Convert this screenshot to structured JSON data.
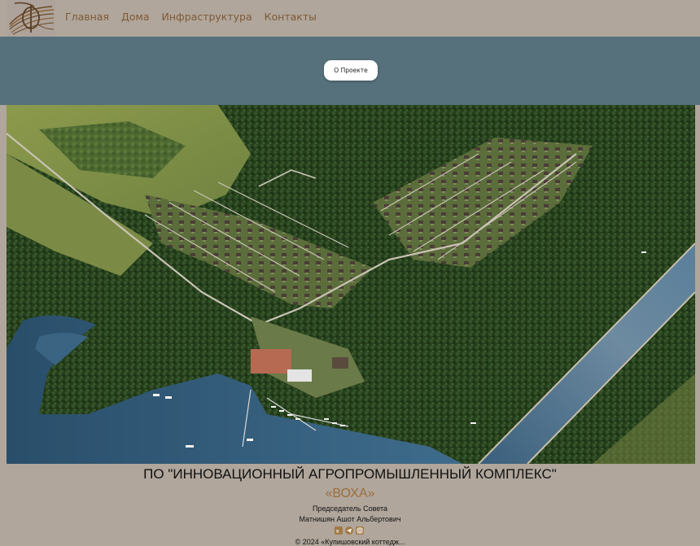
{
  "header": {
    "logo_icon": "fiber-optic-logo-icon",
    "nav": [
      {
        "label": "Главная"
      },
      {
        "label": "Дома"
      },
      {
        "label": "Инфраструктура"
      },
      {
        "label": "Контакты"
      }
    ]
  },
  "band": {
    "about_button": "О Проекте"
  },
  "hero": {
    "image": "aerial-village-lake-canal-image"
  },
  "footer": {
    "org_title": "ПО \"ИННОВАЦИОННЫЙ АГРОПРОМЫШЛЕННЫЙ КОМПЛЕКС\"",
    "org_name": "«ВОХА»",
    "chair_role": "Председатель Совета",
    "chair_name": "Матнишян Ашот Альбертович",
    "socials": [
      "vk-icon",
      "telegram-icon",
      "instagram-icon"
    ],
    "copyright": "© 2024 «Купишовский коттедж..."
  },
  "colors": {
    "header_bg": "#b0a69c",
    "nav_text": "#7f5a35",
    "band_bg": "#56707c",
    "accent": "#9a6e3c"
  }
}
